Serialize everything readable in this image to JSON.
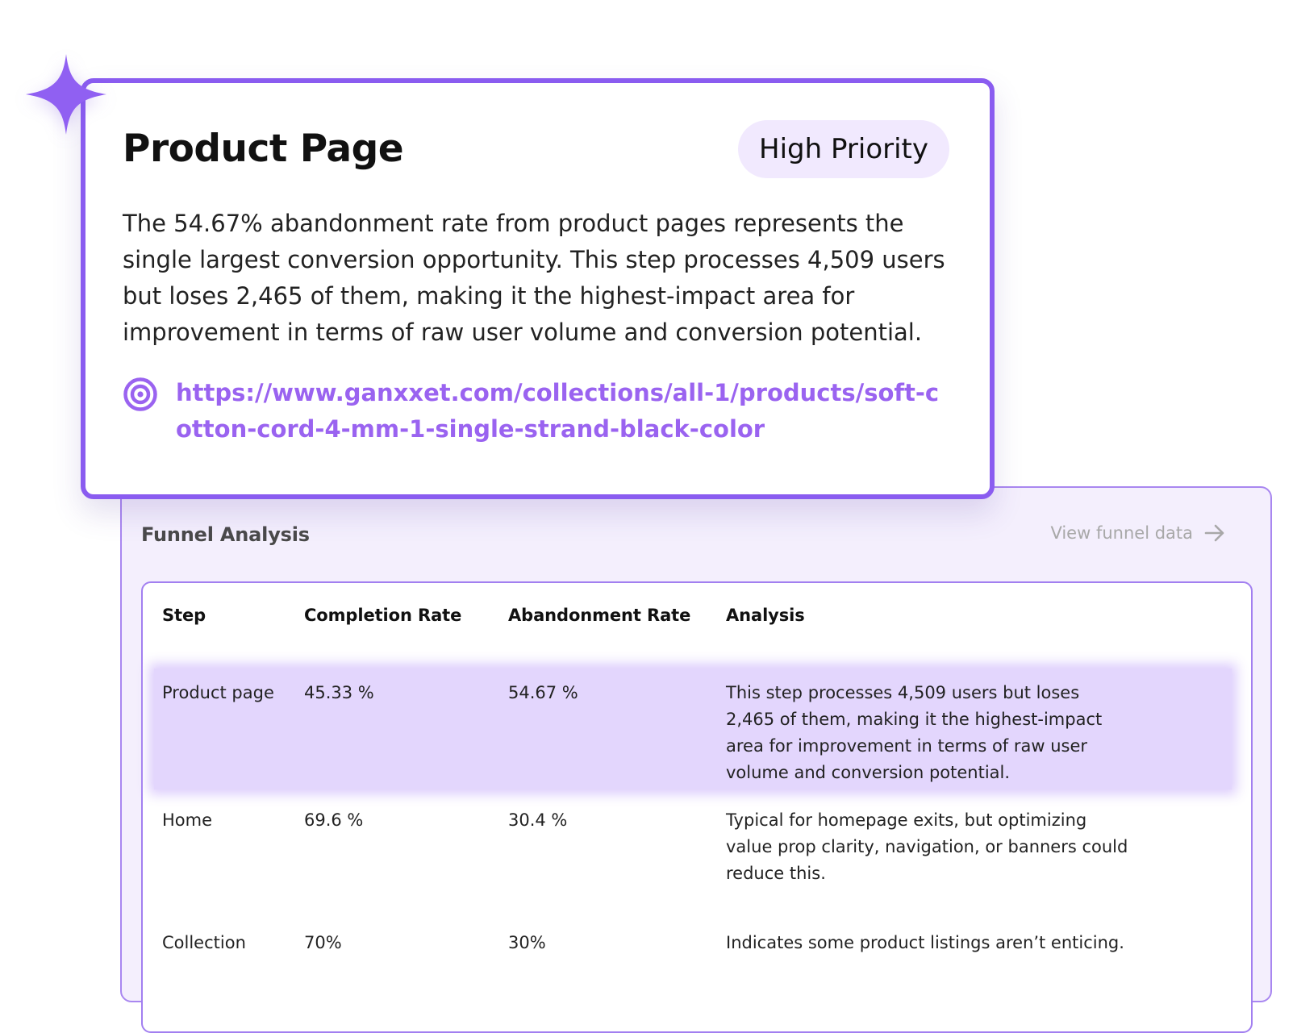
{
  "product_card": {
    "title": "Product Page",
    "priority_badge": "High Priority",
    "description": "The 54.67% abandonment rate from product pages represents the single largest conversion opportunity. This step processes 4,509 users but loses 2,465 of them, making it the highest-impact area for improvement in terms of raw user volume and conversion potential.",
    "link": "https://www.ganxxet.com/collections/all-1/products/soft-cotton-cord-4-mm-1-single-strand-black-color",
    "icons": {
      "sparkle": "sparkle-icon",
      "target": "target-icon"
    }
  },
  "funnel": {
    "title": "Funnel Analysis",
    "view_link": "View funnel data",
    "view_link_icon": "arrow-right-icon",
    "columns": [
      "Step",
      "Completion Rate",
      "Abandonment Rate",
      "Analysis"
    ],
    "rows": [
      {
        "step": "Product page",
        "completion": "45.33 %",
        "abandonment": "54.67 %",
        "analysis": "This step processes 4,509 users but loses 2,465 of them, making it the highest-impact area for improvement in terms of raw user volume and conversion potential.",
        "highlighted": true
      },
      {
        "step": "Home",
        "completion": "69.6 %",
        "abandonment": "30.4 %",
        "analysis": "Typical for homepage exits, but optimizing value prop clarity, navigation, or banners could reduce this.",
        "highlighted": false
      },
      {
        "step": "Collection",
        "completion": "70%",
        "abandonment": "30%",
        "analysis": "Indicates some product listings aren’t enticing.",
        "highlighted": false
      }
    ]
  },
  "colors": {
    "accent": "#8a5cf0",
    "link": "#9a63f0",
    "badge_bg": "#f1e9fe",
    "panel_bg": "#f4effd",
    "highlight_row": "#e3d6fd"
  }
}
